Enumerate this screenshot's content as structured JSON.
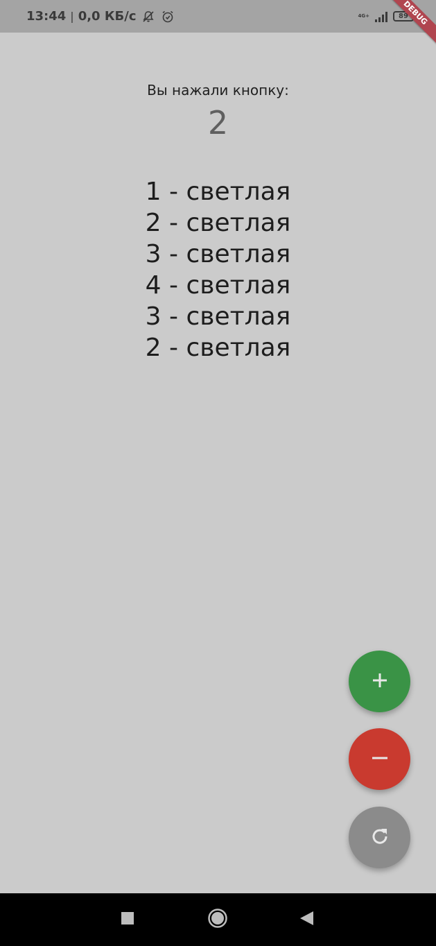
{
  "status_bar": {
    "time": "13:44",
    "separator": "|",
    "network_speed": "0,0 КБ/с",
    "network_type": "4G+",
    "battery": "89",
    "debug_banner": "DEBUG"
  },
  "main": {
    "pressed_label": "Вы нажали кнопку:",
    "counter_value": "2",
    "history": [
      "1 - светлая",
      "2 - светлая",
      "3 - светлая",
      "4 - светлая",
      "3 - светлая",
      "2 - светлая"
    ]
  },
  "fabs": {
    "increment_icon": "plus-icon",
    "decrement_icon": "minus-icon",
    "reset_icon": "refresh-icon"
  },
  "colors": {
    "background": "#cbcbcb",
    "status_bar": "#a4a4a4",
    "increment": "#3a9346",
    "decrement": "#c93a2f",
    "reset": "#8b8b8b"
  },
  "nav_bar": {
    "recents_icon": "square-icon",
    "home_icon": "circle-icon",
    "back_icon": "triangle-back-icon"
  }
}
